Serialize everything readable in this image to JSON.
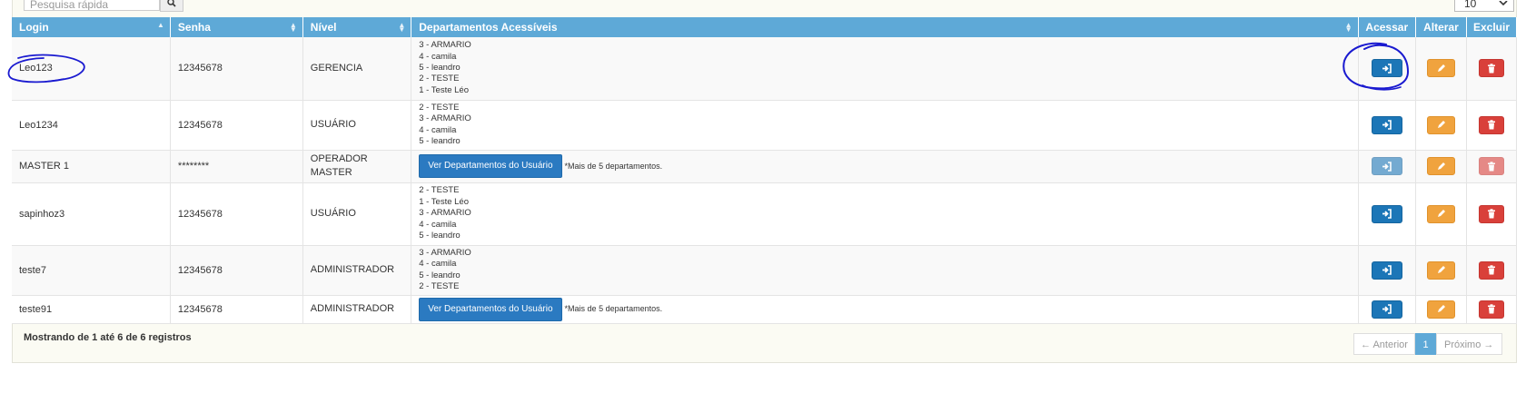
{
  "search": {
    "placeholder": "Pesquisa rápida"
  },
  "page_size": {
    "value": "10"
  },
  "columns": [
    "Login",
    "Senha",
    "Nível",
    "Departamentos Acessíveis",
    "Acessar",
    "Alterar",
    "Excluir"
  ],
  "rows": [
    {
      "login": "Leo123",
      "senha": "12345678",
      "nivel": [
        "GERENCIA"
      ],
      "depts": [
        "3 - ARMARIO",
        "4 - camila",
        "5 - leandro",
        "2 - TESTE",
        "1 - Teste Léo"
      ]
    },
    {
      "login": "Leo1234",
      "senha": "12345678",
      "nivel": [
        "USUÁRIO"
      ],
      "depts": [
        "2 - TESTE",
        "3 - ARMARIO",
        "4 - camila",
        "5 - leandro"
      ]
    },
    {
      "login": "MASTER 1",
      "senha": "********",
      "nivel": [
        "OPERADOR",
        "MASTER"
      ],
      "ver_button": "Ver Departamentos do Usuário",
      "note": "*Mais de 5 departamentos."
    },
    {
      "login": "sapinhoz3",
      "senha": "12345678",
      "nivel": [
        "USUÁRIO"
      ],
      "depts": [
        "2 - TESTE",
        "1 - Teste Léo",
        "3 - ARMARIO",
        "4 - camila",
        "5 - leandro"
      ]
    },
    {
      "login": "teste7",
      "senha": "12345678",
      "nivel": [
        "ADMINISTRADOR"
      ],
      "depts": [
        "3 - ARMARIO",
        "4 - camila",
        "5 - leandro",
        "2 - TESTE"
      ]
    },
    {
      "login": "teste91",
      "senha": "12345678",
      "nivel": [
        "ADMINISTRADOR"
      ],
      "ver_button": "Ver Departamentos do Usuário",
      "note": "*Mais de 5 departamentos."
    }
  ],
  "footer": {
    "info": "Mostrando de 1 até 6 de 6 registros"
  },
  "pagination": {
    "prev": "← Anterior",
    "current": "1",
    "next": "Próximo →"
  },
  "colors": {
    "header": "#5ea9d7",
    "access": "#1c76b7",
    "edit": "#f0a33e",
    "delete": "#d9403a",
    "annotation": "#1a1ad0"
  },
  "icons": {
    "search": "search-icon",
    "access": "sign-in-icon",
    "edit": "pencil-icon",
    "delete": "trash-icon",
    "sort": "sort-icon"
  }
}
